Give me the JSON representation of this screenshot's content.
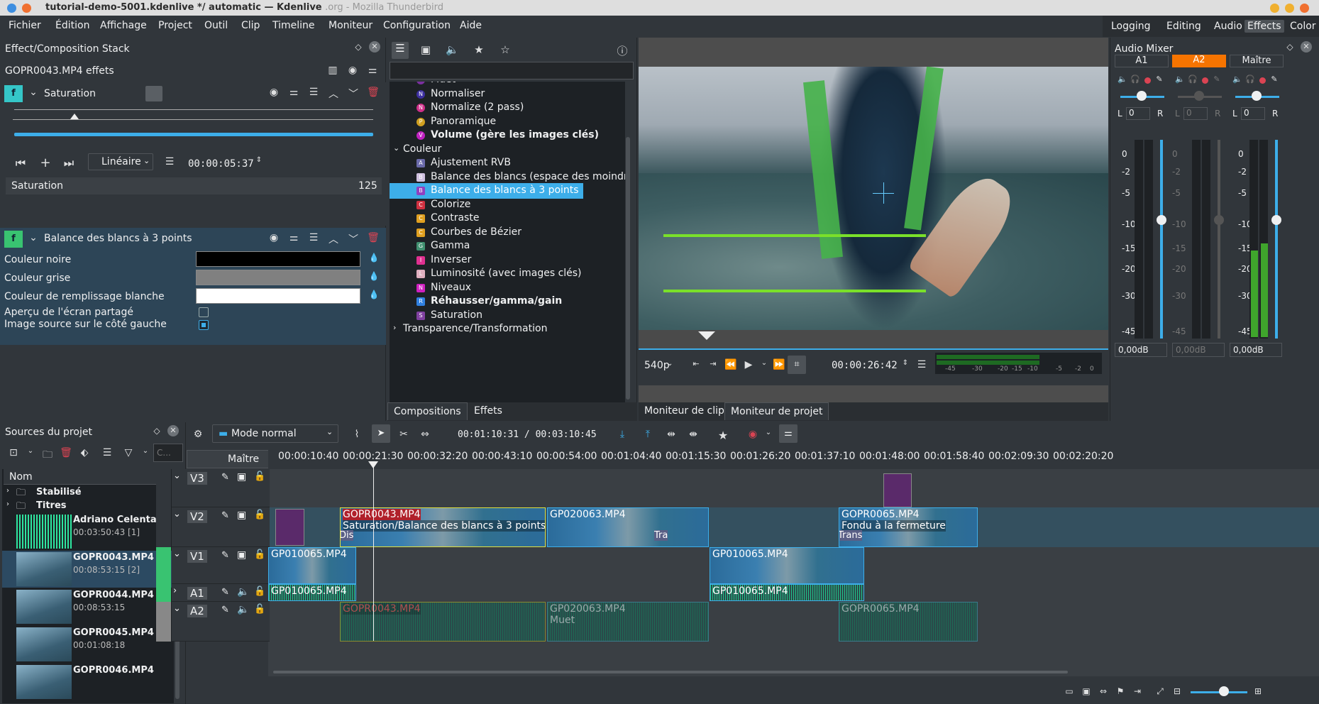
{
  "window": {
    "title": "tutorial-demo-5001.kdenlive */ automatic — Kdenlive",
    "title_ghost": ".org - Mozilla Thunderbird"
  },
  "menu": [
    "Fichier",
    "Édition",
    "Affichage",
    "Project",
    "Outil",
    "Clip",
    "Timeline",
    "Moniteur",
    "Configuration",
    "Aide"
  ],
  "layouts": [
    "Logging",
    "Editing",
    "Audio",
    "Effects",
    "Color"
  ],
  "effect_stack": {
    "panel_title": "Effect/Composition Stack",
    "clip_title": "GOPR0043.MP4 effets",
    "effect1": {
      "name": "Saturation",
      "interp": "Linéaire",
      "timecode": "00:00:05:37",
      "param_label": "Saturation",
      "param_value": "125"
    },
    "effect2": {
      "name": "Balance des blancs à 3 points",
      "rows": [
        "Couleur noire",
        "Couleur grise",
        "Couleur de remplissage blanche"
      ],
      "checks": [
        "Aperçu de l'écran partagé",
        "Image source sur le côté gauche"
      ],
      "colors": [
        "#000000",
        "#808080",
        "#ffffff"
      ]
    }
  },
  "effects_list": {
    "items": [
      {
        "label": "Muet",
        "icon": "M",
        "color": "#7b2fa0",
        "round": true,
        "bold": false
      },
      {
        "label": "Normaliser",
        "icon": "N",
        "color": "#3c2fa0",
        "round": true,
        "bold": false
      },
      {
        "label": "Normalize (2 pass)",
        "icon": "N",
        "color": "#d0308a",
        "round": true,
        "bold": false
      },
      {
        "label": "Panoramique",
        "icon": "P",
        "color": "#d0a020",
        "round": true,
        "bold": false
      },
      {
        "label": "Volume (gère les images clés)",
        "icon": "V",
        "color": "#c020c0",
        "round": true,
        "bold": true
      }
    ],
    "category": "Couleur",
    "color_items": [
      {
        "label": "Ajustement RVB",
        "icon": "A",
        "color": "#6a6aaa",
        "bold": false
      },
      {
        "label": "Balance des blancs (espace des moindre",
        "icon": "B",
        "color": "#d0c0e0",
        "bold": false
      },
      {
        "label": "Balance des blancs à 3 points",
        "icon": "B",
        "color": "#9040c0",
        "bold": false
      },
      {
        "label": "Colorize",
        "icon": "C",
        "color": "#d03040",
        "bold": false
      },
      {
        "label": "Contraste",
        "icon": "C",
        "color": "#e0a020",
        "bold": false
      },
      {
        "label": "Courbes de Bézier",
        "icon": "C",
        "color": "#e0a020",
        "bold": false
      },
      {
        "label": "Gamma",
        "icon": "G",
        "color": "#409070",
        "bold": false
      },
      {
        "label": "Inverser",
        "icon": "I",
        "color": "#e03090",
        "bold": false
      },
      {
        "label": "Luminosité (avec images clés)",
        "icon": "L",
        "color": "#e0b0c0",
        "bold": false
      },
      {
        "label": "Niveaux",
        "icon": "N",
        "color": "#d020c0",
        "bold": false
      },
      {
        "label": "Réhausser/gamma/gain",
        "icon": "R",
        "color": "#3080e0",
        "bold": true
      },
      {
        "label": "Saturation",
        "icon": "S",
        "color": "#8040a0",
        "bold": false
      }
    ],
    "category2": "Transparence/Transformation",
    "tabs": [
      "Compositions",
      "Effets"
    ]
  },
  "monitor": {
    "resolution": "540p",
    "timecode": "00:00:26:42",
    "tabs": [
      "Moniteur de clip",
      "Moniteur de projet"
    ],
    "scale": [
      "-45",
      "-30",
      "-20",
      "-15",
      "-10",
      "-5",
      "-2",
      "0"
    ]
  },
  "mixer": {
    "title": "Audio Mixer",
    "channels": [
      {
        "name": "A1",
        "db": "0,00dB",
        "lvl": "0"
      },
      {
        "name": "A2",
        "db": "0,00dB",
        "lvl": "0"
      },
      {
        "name": "Maître",
        "db": "0,00dB",
        "lvl": "0"
      }
    ],
    "scale": [
      "0",
      "-2",
      "-5",
      "-10",
      "-15",
      "-20",
      "-30",
      "-45"
    ]
  },
  "bin": {
    "title": "Sources du projet",
    "search_placeholder": "C...",
    "column": "Nom",
    "folders": [
      "Stabilisé",
      "Titres"
    ],
    "clips": [
      {
        "name": "Adriano Celenta",
        "info": "00:03:50:43 [1]"
      },
      {
        "name": "GOPR0043.MP4",
        "info": "00:08:53:15 [2]"
      },
      {
        "name": "GOPR0044.MP4",
        "info": "00:08:53:15"
      },
      {
        "name": "GOPR0045.MP4",
        "info": "00:01:08:18"
      },
      {
        "name": "GOPR0046.MP4",
        "info": ""
      }
    ]
  },
  "timeline": {
    "mode": "Mode normal",
    "position": "00:01:10:31 / 00:03:10:45",
    "master": "Maître",
    "ruler": [
      "00:00:10:40",
      "00:00:21:30",
      "00:00:32:20",
      "00:00:43:10",
      "00:00:54:00",
      "00:01:04:40",
      "00:01:15:30",
      "00:01:26:20",
      "00:01:37:10",
      "00:01:48:00",
      "00:01:58:40",
      "00:02:09:30",
      "00:02:20:20"
    ],
    "tracks": [
      "V3",
      "V2",
      "V1",
      "A1",
      "A2"
    ],
    "clips": {
      "v2a": "GOPR0043.MP4",
      "v2a_fx": "Saturation/Balance des blancs à 3 points",
      "v2a_tr": "Dis",
      "v2b": "GP020063.MP4",
      "v2b_tr": "Tra",
      "v2c": "GOPR0065.MP4",
      "v2c_fx": "Fondu à la fermeture",
      "v2c_tr": "Trans",
      "v1a": "GP010065.MP4",
      "v1b": "GP010065.MP4",
      "a1a": "GP010065.MP4",
      "a1b": "GP010065.MP4",
      "a2a": "GOPR0043.MP4",
      "a2b": "GP020063.MP4",
      "a2b_fx": "Muet",
      "a2c": "GOPR0065.MP4"
    }
  }
}
